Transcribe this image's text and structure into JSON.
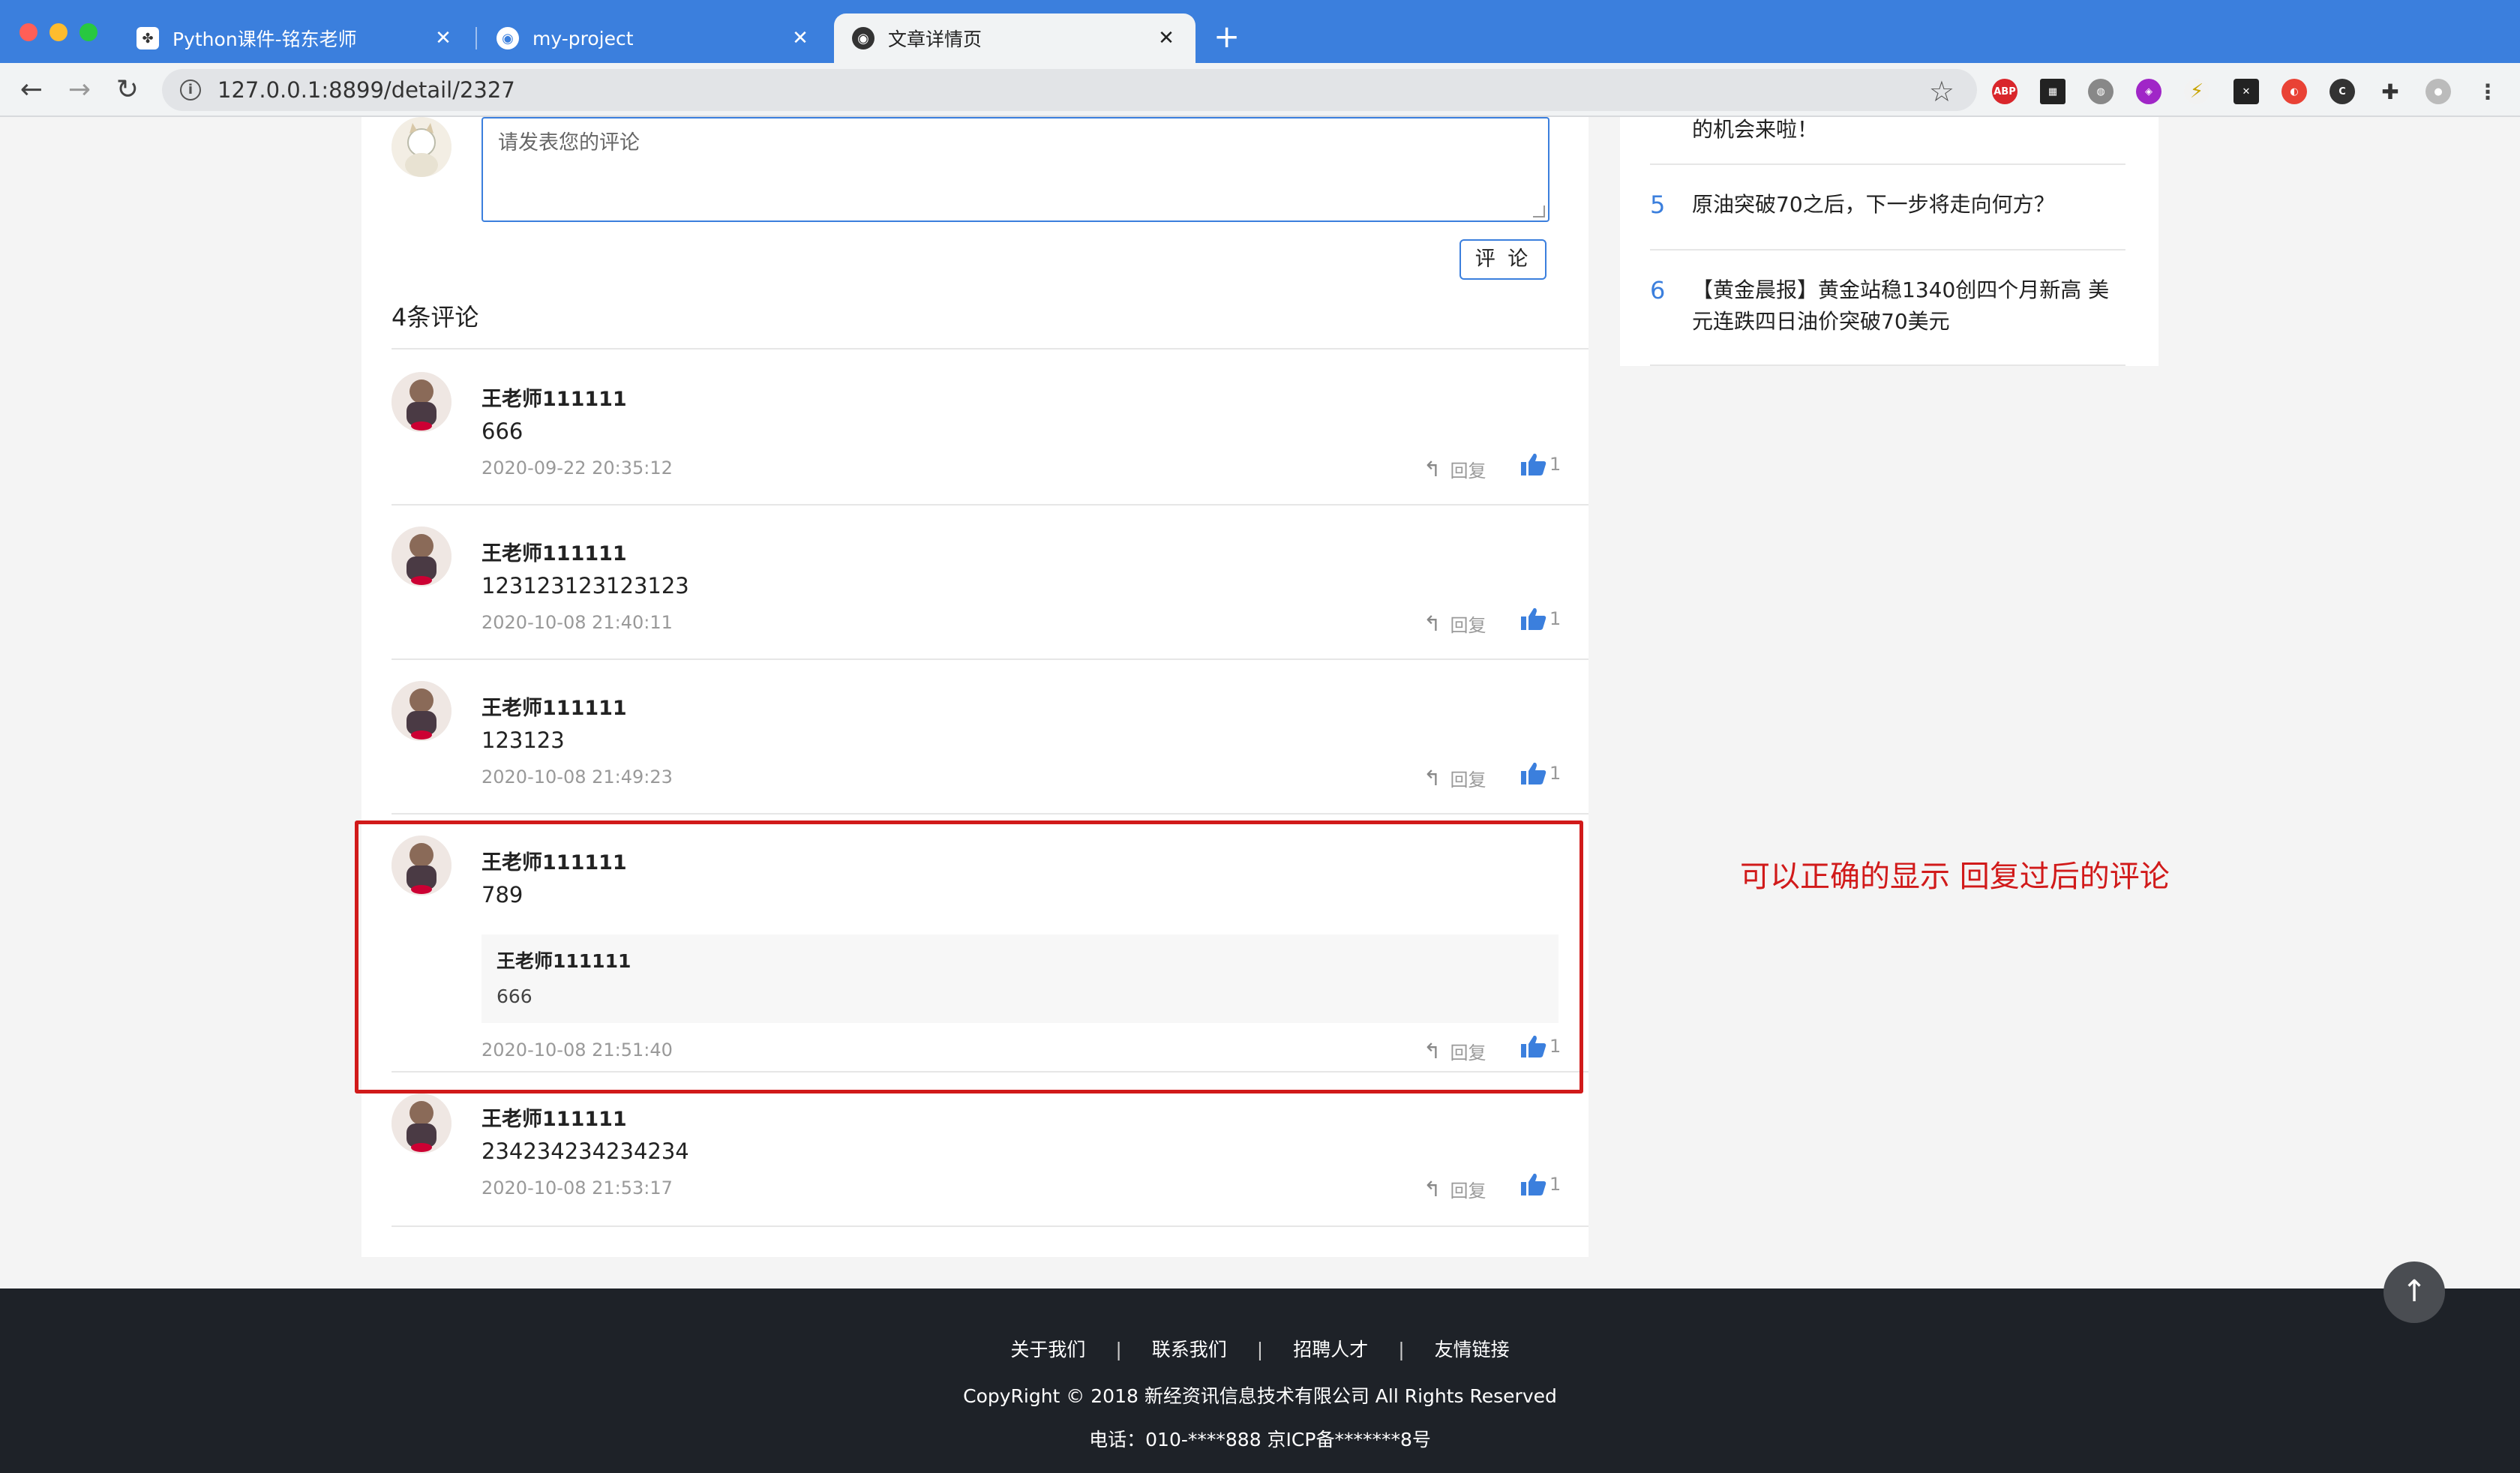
{
  "browser": {
    "tabs": [
      {
        "title": "Python课件-铭东老师",
        "active": false
      },
      {
        "title": "my-project",
        "active": false
      },
      {
        "title": "文章详情页",
        "active": true
      }
    ],
    "url": "127.0.0.1:8899/detail/2327",
    "extensions": [
      "ABP"
    ]
  },
  "comment_form": {
    "placeholder": "请发表您的评论",
    "submit_label": "评 论"
  },
  "comments_count_label": "4条评论",
  "comments": [
    {
      "author": "王老师111111",
      "content": "666",
      "time": "2020-09-22 20:35:12",
      "reply_label": "回复",
      "likes": "1"
    },
    {
      "author": "王老师111111",
      "content": "123123123123123",
      "time": "2020-10-08 21:40:11",
      "reply_label": "回复",
      "likes": "1"
    },
    {
      "author": "王老师111111",
      "content": "123123",
      "time": "2020-10-08 21:49:23",
      "reply_label": "回复",
      "likes": "1"
    },
    {
      "author": "王老师111111",
      "content": "789",
      "quote_author": "王老师111111",
      "quote_content": "666",
      "time": "2020-10-08 21:51:40",
      "reply_label": "回复",
      "likes": "1"
    },
    {
      "author": "王老师111111",
      "content": "234234234234234",
      "time": "2020-10-08 21:53:17",
      "reply_label": "回复",
      "likes": "1"
    }
  ],
  "annotation": "可以正确的显示 回复过后的评论",
  "sidebar": {
    "items": [
      {
        "num": "",
        "text": "的机会来啦！"
      },
      {
        "num": "5",
        "text": "原油突破70之后，下一步将走向何方？"
      },
      {
        "num": "6",
        "text": "【黄金晨报】黄金站稳1340创四个月新高 美元连跌四日油价突破70美元"
      }
    ]
  },
  "footer": {
    "links": [
      "关于我们",
      "联系我们",
      "招聘人才",
      "友情链接"
    ],
    "copyright": "CopyRight © 2018 新经资讯信息技术有限公司 All Rights Reserved",
    "tel": "电话：010-****888 京ICP备*******8号"
  },
  "colors": {
    "accent": "#3b7fdd",
    "annotation": "#d11a1a",
    "footer_bg": "#1e2228"
  }
}
